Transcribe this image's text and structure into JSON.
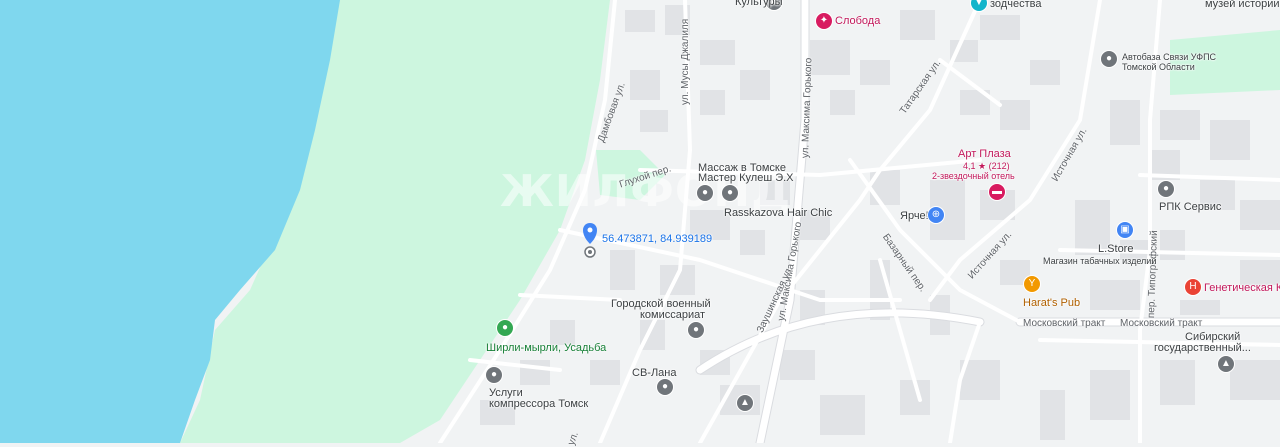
{
  "map": {
    "colors": {
      "water": "#7fd7ee",
      "park": "#cdf6df",
      "land": "#f1f3f4",
      "road": "#ffffff",
      "road_casing": "#dadce0",
      "building": "#e1e3e6"
    },
    "watermark": "ЖИЛФОНД",
    "pois": [
      {
        "id": "kultury",
        "name": "Культуры",
        "color": "gray",
        "icon": "museum-icon"
      },
      {
        "id": "sloboda",
        "name": "Слобода",
        "color": "pink",
        "icon": "restaurant-icon"
      },
      {
        "id": "zodchestva",
        "name": "зодчества",
        "color": "teal",
        "icon": "landmark-icon"
      },
      {
        "id": "muzei",
        "name": "музей истории...",
        "color": "gray",
        "icon": ""
      },
      {
        "id": "avtobaza",
        "name": "Автобаза Связи УФПС Томской Области",
        "name_line1": "Автобаза Связи УФПС",
        "name_line2": "Томской Области",
        "color": "gray",
        "icon": "location-icon"
      },
      {
        "id": "artplaza",
        "name": "Арт Плаза",
        "rating": "4,1 ★ (212)",
        "subtitle": "2-звездочный отель",
        "color": "pink",
        "icon": "hotel-icon"
      },
      {
        "id": "massage",
        "name": "Массаж в Томске Мастер Кулеш Э.Х",
        "name_line1": "Массаж в Томске",
        "name_line2": "Мастер Кулеш Э.Х",
        "color": "gray",
        "icon": "location-icon"
      },
      {
        "id": "rasskazova",
        "name": "Rasskazova Hair Chic",
        "color": "gray",
        "icon": "location-icon"
      },
      {
        "id": "yarche",
        "name": "Ярче!",
        "color": "blue",
        "icon": "shopping-cart-icon"
      },
      {
        "id": "rpk",
        "name": "РПК Сервис",
        "color": "gray",
        "icon": "location-icon"
      },
      {
        "id": "lstore",
        "name": "L.Store",
        "subtitle": "Магазин табачных изделий",
        "color": "blue",
        "icon": "shopping-bag-icon"
      },
      {
        "id": "genetic",
        "name": "Генетическая Кл",
        "color": "red",
        "icon": "hospital-icon"
      },
      {
        "id": "harats",
        "name": "Harat's Pub",
        "color": "orange",
        "icon": "bar-icon"
      },
      {
        "id": "voenkomat",
        "name": "Городской военный комиссариат",
        "name_line1": "Городской военный",
        "name_line2": "комиссариат",
        "color": "gray",
        "icon": "location-icon"
      },
      {
        "id": "sibirsky",
        "name": "Сибирский государственный...",
        "name_line1": "Сибирский",
        "name_line2": "государственный...",
        "color": "gray",
        "icon": ""
      },
      {
        "id": "shirli",
        "name": "Ширли-мырли, Усадьба",
        "color": "green",
        "icon": "park-icon"
      },
      {
        "id": "uslugi",
        "name": "Услуги компрессора Томск",
        "name_line1": "Услуги",
        "name_line2": "компрессора Томск",
        "color": "gray",
        "icon": "location-icon"
      },
      {
        "id": "svlana",
        "name": "СВ-Лана",
        "color": "gray",
        "icon": "location-icon"
      }
    ],
    "streets": {
      "musy_dzhalilya": "ул. Мусы Джалиля",
      "maksima_gorkogo_1": "ул. Максима Горького",
      "maksima_gorkogo_2": "ул. Максима Горького",
      "tatarskaya": "Татарская ул.",
      "istochnaya_1": "Источная ул.",
      "istochnaya_2": "Источная ул.",
      "damba": "Дамбовая ул.",
      "glukhoy": "Глухой пер.",
      "bazarny": "Базарный пер.",
      "zaushtinskaya": "Заушинская ул.",
      "tipografsky": "пер. Типографский",
      "moskovsky_1": "Московский тракт",
      "moskovsky_2": "Московский тракт",
      "bottom_fragment": "ул."
    },
    "marker": {
      "coords_text": "56.473871, 84.939189",
      "color": "#4285f4"
    }
  }
}
